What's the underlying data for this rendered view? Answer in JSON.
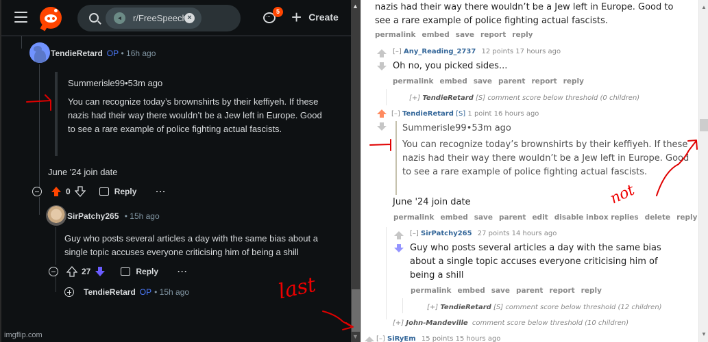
{
  "left_panel": {
    "header": {
      "subreddit_chip": "r/FreeSpeech",
      "notification_count": "5",
      "create_label": "Create"
    },
    "comment_op": {
      "author": "TendieRetard",
      "op_badge": "OP",
      "meta": "• 16h ago",
      "quote_header": "Summerisle99•53m ago",
      "quote_text": "You can recognize today’s brownshirts by their keffiyeh. If these nazis had their way there wouldn’t be a Jew left in Europe. Good to see a rare example of police fighting actual fascists.",
      "body": "June '24 join date",
      "score": "0",
      "vote_state": "upvoted",
      "reply_label": "Reply",
      "more_label": "···"
    },
    "comment_reply": {
      "author": "SirPatchy265",
      "meta": "• 15h ago",
      "body": "Guy who posts several articles a day with the same bias about a single topic accuses everyone criticising him of being a shill",
      "score": "27",
      "vote_state": "downvoted",
      "reply_label": "Reply",
      "more_label": "···"
    },
    "collapsed_reply": {
      "author": "TendieRetard",
      "op_badge": "OP",
      "meta": "• 15h ago"
    },
    "watermark": "imgflip.com",
    "annotation": "last"
  },
  "right_panel": {
    "top_comment_tail": "nazis had their way there wouldn’t be a Jew left in Europe. Good to see a rare example of police fighting actual fascists.",
    "top_comment_buttons": [
      "permalink",
      "embed",
      "save",
      "report",
      "reply"
    ],
    "comment_any_reading": {
      "expand": "[–]",
      "author": "Any_Reading_2737",
      "score_time": "12 points 17 hours ago",
      "body": "Oh no, you picked sides...",
      "buttons": [
        "permalink",
        "embed",
        "save",
        "parent",
        "report",
        "reply"
      ]
    },
    "collapsed_1": {
      "expand": "[+]",
      "author": "TendieRetard",
      "flair": "[S]",
      "note": "comment score below threshold  (0 children)"
    },
    "comment_tendie": {
      "expand": "[–]",
      "author": "TendieRetard",
      "flair": "[S]",
      "score_time": "1 point 16 hours ago",
      "quote_header": "Summerisle99•53m ago",
      "quote_text": "You can recognize today’s brownshirts by their keffiyeh. If these nazis had their way there wouldn’t be a Jew left in Europe. Good to see a rare example of police fighting actual fascists.",
      "body": "June '24 join date",
      "buttons": [
        "permalink",
        "embed",
        "save",
        "parent",
        "edit",
        "disable inbox replies",
        "delete",
        "reply"
      ]
    },
    "comment_patchy": {
      "expand": "[–]",
      "author": "SirPatchy265",
      "score_time": "27 points 14 hours ago",
      "body": "Guy who posts several articles a day with the same bias about a single topic accuses everyone criticising him of being a shill",
      "buttons": [
        "permalink",
        "embed",
        "save",
        "parent",
        "report",
        "reply"
      ]
    },
    "collapsed_2": {
      "expand": "[+]",
      "author": "TendieRetard",
      "flair": "[S]",
      "note": "comment score below threshold  (12 children)"
    },
    "collapsed_3": {
      "expand": "[+]",
      "author": "John-Mandeville",
      "note": "comment score below threshold  (10 children)"
    },
    "partial_comment": {
      "expand": "[–]",
      "author": "SiRyEm",
      "score_time": "15 points 15 hours ago"
    },
    "annotation": "not"
  },
  "colors": {
    "reddit_orange": "#ff4500",
    "op_blue": "#4d7cff",
    "downvote_purple": "#6a5cff",
    "old_author_blue": "#336699",
    "old_upmod": "#ff8b60",
    "old_downmod": "#9494ff",
    "annotation_red": "#e00000"
  }
}
